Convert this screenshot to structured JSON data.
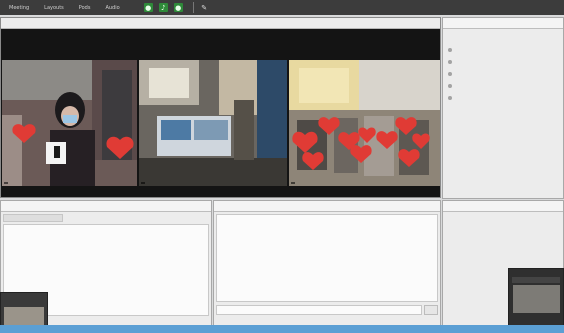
{
  "menubar": {
    "items": [
      "Meeting",
      "Layouts",
      "Pods",
      "Audio"
    ],
    "icons": [
      "webcam-icon",
      "microphone-icon",
      "person-icon",
      "pencil-icon"
    ]
  },
  "video_pod": {
    "tiles": [
      {
        "name": ""
      },
      {
        "name": ""
      },
      {
        "name": ""
      }
    ]
  },
  "attendees_pod": {
    "title": "",
    "rows": [
      "",
      "",
      "",
      "",
      ""
    ]
  },
  "notes_pod": {
    "title": ""
  },
  "chat_pod": {
    "title": "",
    "message": ""
  },
  "files_pod": {
    "title": "",
    "labels": [
      "",
      ""
    ]
  },
  "colors": {
    "menubar_bg": "#3c3c3c",
    "video_bg": "#141414",
    "heart": "#e03b35",
    "taskbar": "#5b9fd4"
  }
}
